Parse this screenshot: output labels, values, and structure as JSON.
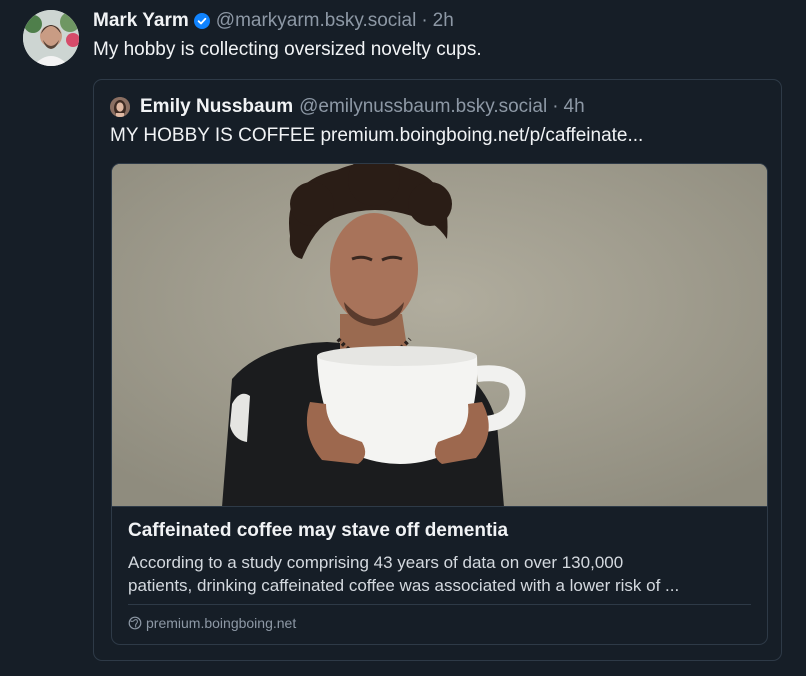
{
  "post": {
    "author_name": "Mark Yarm",
    "handle": "@markyarm.bsky.social",
    "separator": "·",
    "time": "2h",
    "text": "My hobby is collecting oversized novelty cups.",
    "verified_icon": "verified-check-icon"
  },
  "quote": {
    "author_name": "Emily Nussbaum",
    "handle": "@emilynussbaum.bsky.social",
    "separator": "·",
    "time": "4h",
    "text": "MY HOBBY IS COFFEE premium.boingboing.net/p/caffeinate...",
    "card": {
      "title": "Caffeinated coffee may stave off dementia",
      "description_line1": "According to a study comprising 43 years of data on over 130,000",
      "description_line2": "patients, drinking caffeinated coffee was associated with a lower risk of ...",
      "domain": "premium.boingboing.net",
      "domain_icon": "globe-icon"
    }
  },
  "colors": {
    "background": "#161e27",
    "border": "#2e3a47",
    "muted_text": "#8d98a5",
    "verified": "#1083fe"
  }
}
